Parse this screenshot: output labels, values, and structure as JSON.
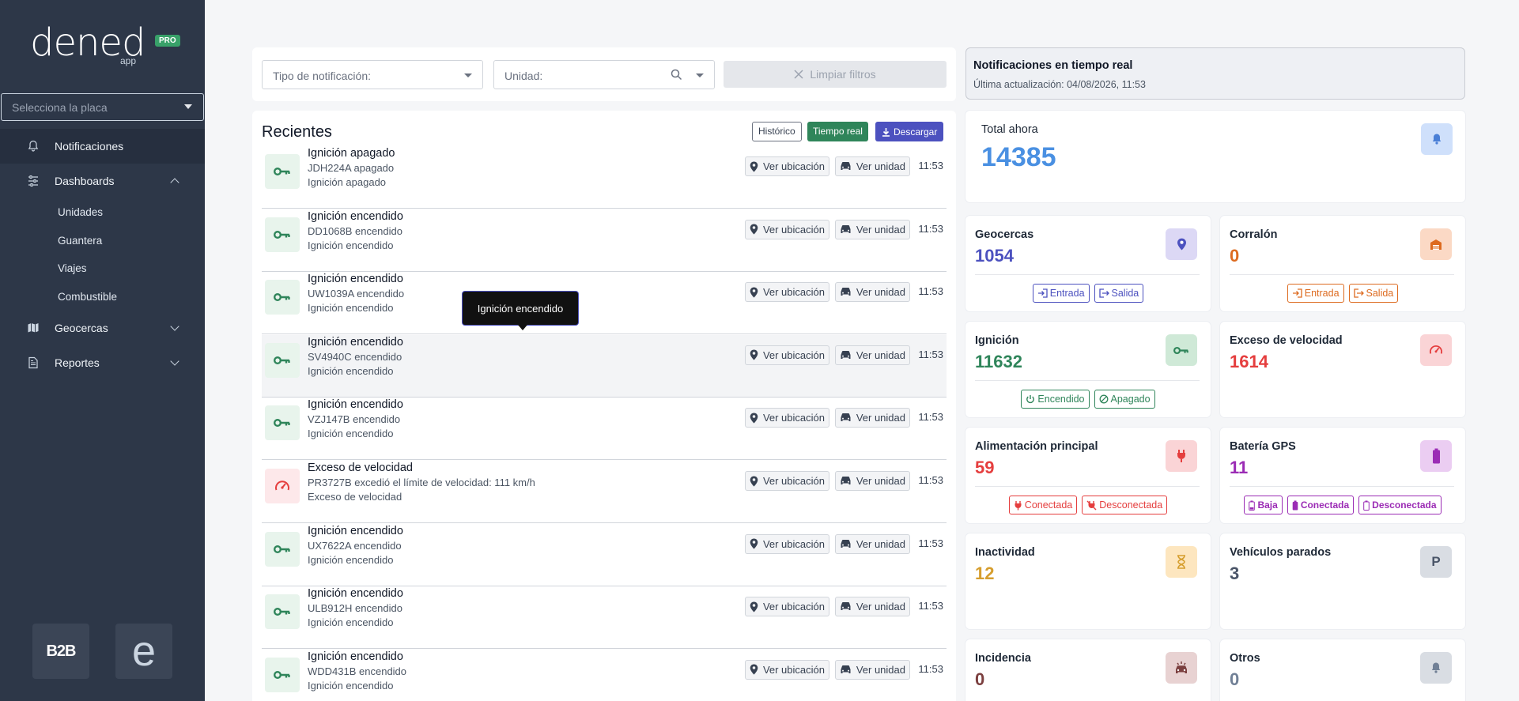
{
  "sidebar": {
    "brand": "dened",
    "brand_sub": "app",
    "brand_badge": "PRO",
    "plate_placeholder": "Selecciona la placa",
    "nav": {
      "notificaciones": "Notificaciones",
      "dashboards": "Dashboards",
      "geocercas": "Geocercas",
      "reportes": "Reportes"
    },
    "dashboards_sub": [
      "Unidades",
      "Guantera",
      "Viajes",
      "Combustible"
    ],
    "bottom_logos": [
      "B2B",
      "e"
    ]
  },
  "filters": {
    "type_placeholder": "Tipo de notificación:",
    "unit_placeholder": "Unidad:",
    "clear_label": "Limpiar filtros"
  },
  "list": {
    "title": "Recientes",
    "historico_label": "Histórico",
    "tiempo_real_label": "Tiempo real",
    "descargar_label": "Descargar",
    "ver_ubicacion": "Ver ubicación",
    "ver_unidad": "Ver unidad",
    "tooltip": "Ignición encendido",
    "rows": [
      {
        "kind": "key",
        "title": "Ignición apagado",
        "sub": "JDH224A apagado",
        "desc": "Ignición apagado",
        "time": "11:53"
      },
      {
        "kind": "key",
        "title": "Ignición encendido",
        "sub": "DD1068B encendido",
        "desc": "Ignición encendido",
        "time": "11:53"
      },
      {
        "kind": "key",
        "title": "Ignición encendido",
        "sub": "UW1039A encendido",
        "desc": "Ignición encendido",
        "time": "11:53"
      },
      {
        "kind": "key",
        "title": "Ignición encendido",
        "sub": "SV4940C encendido",
        "desc": "Ignición encendido",
        "time": "11:53"
      },
      {
        "kind": "key",
        "title": "Ignición encendido",
        "sub": "VZJ147B encendido",
        "desc": "Ignición encendido",
        "time": "11:53"
      },
      {
        "kind": "speed",
        "title": "Exceso de velocidad",
        "sub": "PR3727B excedió el límite de velocidad: 111 km/h",
        "desc": "Exceso de velocidad",
        "time": "11:53"
      },
      {
        "kind": "key",
        "title": "Ignición encendido",
        "sub": "UX7622A encendido",
        "desc": "Ignición encendido",
        "time": "11:53"
      },
      {
        "kind": "key",
        "title": "Ignición encendido",
        "sub": "ULB912H encendido",
        "desc": "Ignición encendido",
        "time": "11:53"
      },
      {
        "kind": "key",
        "title": "Ignición encendido",
        "sub": "WDD431B encendido",
        "desc": "Ignición encendido",
        "time": "11:53"
      }
    ]
  },
  "realtime": {
    "title": "Notificaciones en tiempo real",
    "updated": "Última actualización: 04/08/2026, 11:53"
  },
  "stats": {
    "total": {
      "title": "Total ahora",
      "value": "14385",
      "color": "#4a90e2"
    },
    "geocercas": {
      "title": "Geocercas",
      "value": "1054",
      "color": "#4c51bf",
      "tags": [
        "Entrada",
        "Salida"
      ]
    },
    "corralon": {
      "title": "Corralón",
      "value": "0",
      "color": "#dd6b20",
      "tags": [
        "Entrada",
        "Salida"
      ]
    },
    "ignicion": {
      "title": "Ignición",
      "value": "11632",
      "color": "#2f855a",
      "tags": [
        "Encendido",
        "Apagado"
      ]
    },
    "exceso": {
      "title": "Exceso de velocidad",
      "value": "1614",
      "color": "#e53e3e"
    },
    "alimentacion": {
      "title": "Alimentación principal",
      "value": "59",
      "color": "#e53e3e",
      "tags": [
        "Conectada",
        "Desconectada"
      ]
    },
    "bateria": {
      "title": "Batería GPS",
      "value": "11",
      "color": "#9b2cb5",
      "tags": [
        "Baja",
        "Conectada",
        "Desconectada"
      ]
    },
    "inactividad": {
      "title": "Inactividad",
      "value": "12",
      "color": "#d69e2e"
    },
    "parados": {
      "title": "Vehículos parados",
      "value": "3",
      "color": "#4a5568"
    },
    "incidencia": {
      "title": "Incidencia",
      "value": "0",
      "color": "#7b3f3f"
    },
    "otros": {
      "title": "Otros",
      "value": "0",
      "color": "#718096"
    }
  }
}
